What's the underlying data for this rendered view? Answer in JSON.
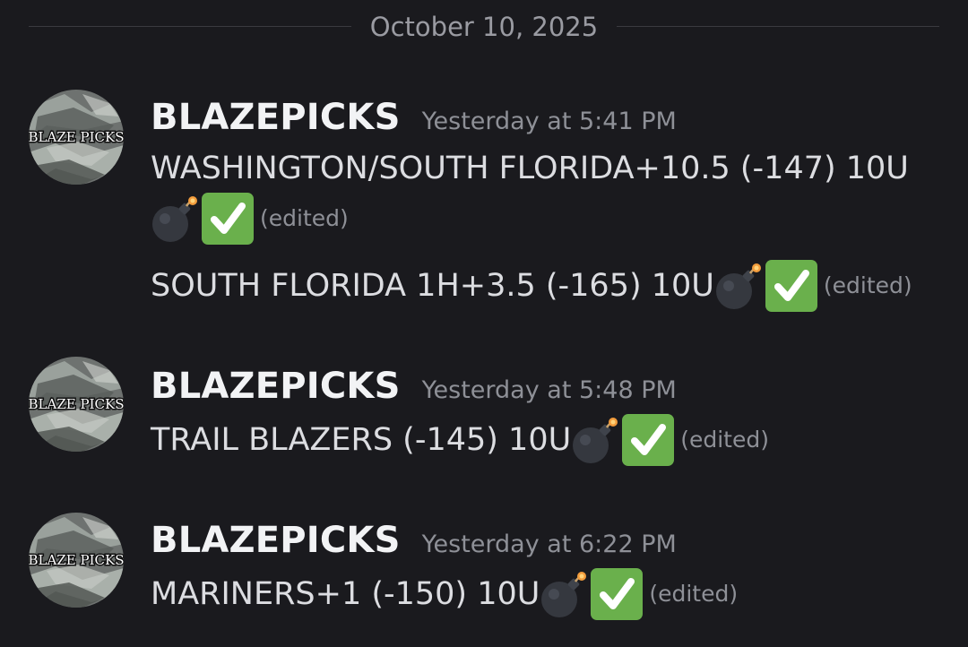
{
  "divider": {
    "date": "October 10, 2025"
  },
  "messages": [
    {
      "username": "BLAZEPICKS",
      "timestamp": "Yesterday at 5:41 PM",
      "avatar_text": "BLAZE PICKS",
      "lines": [
        {
          "text": "WASHINGTON/SOUTH FLORIDA+10.5 (-147) 10U",
          "edited": "(edited)"
        },
        {
          "text": "SOUTH FLORIDA 1H+3.5 (-165) 10U",
          "edited": "(edited)"
        }
      ]
    },
    {
      "username": "BLAZEPICKS",
      "timestamp": "Yesterday at 5:48 PM",
      "avatar_text": "BLAZE PICKS",
      "lines": [
        {
          "text": "TRAIL BLAZERS (-145) 10U",
          "edited": "(edited)"
        }
      ]
    },
    {
      "username": "BLAZEPICKS",
      "timestamp": "Yesterday at 6:22 PM",
      "avatar_text": "BLAZE PICKS",
      "lines": [
        {
          "text": "MARINERS+1 (-150) 10U",
          "edited": "(edited)"
        }
      ]
    }
  ],
  "icons": {
    "bomb": "bomb-emoji-icon",
    "check": "white-check-mark-emoji-icon"
  },
  "colors": {
    "background": "#1a1a1e",
    "username": "#f2f3f5",
    "timestamp": "#8e9097",
    "check_green": "#6ab04c"
  }
}
